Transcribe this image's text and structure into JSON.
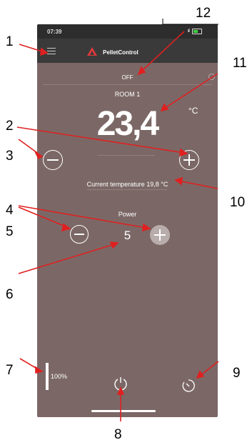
{
  "status_bar": {
    "time": "07:39",
    "signal": "ııl"
  },
  "app": {
    "brand": "PelletControl"
  },
  "stove": {
    "state": "OFF",
    "room": "ROOM 1",
    "setpoint": "23,4",
    "unit": "°C",
    "current_temperature_text": "Current temperature 19,8 °C",
    "power_label": "Power",
    "power_value": "5",
    "fuel_level": "100%"
  },
  "icons": [
    "menu-icon",
    "flame-logo-icon",
    "clock-icon",
    "minus-icon",
    "plus-icon",
    "power-icon",
    "timer-icon"
  ],
  "colors": {
    "background": "#7b6866",
    "appbar": "#3a3a3a",
    "callout_arrow": "#e02020",
    "logo_red": "#e0383c"
  },
  "callouts": {
    "c1": "1",
    "c2": "2",
    "c3": "3",
    "c4": "4",
    "c5": "5",
    "c6": "6",
    "c7": "7",
    "c8": "8",
    "c9": "9",
    "c10": "10",
    "c11": "11",
    "c12": "12"
  }
}
